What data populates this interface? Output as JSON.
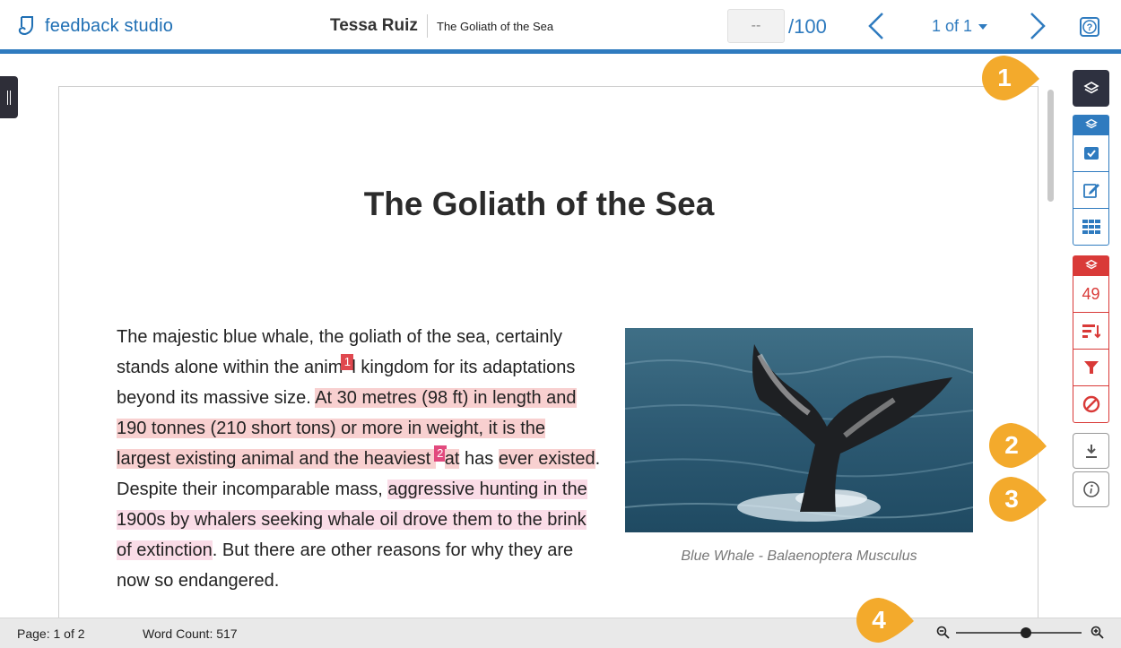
{
  "header": {
    "app_name": "feedback studio",
    "student_name": "Tessa Ruiz",
    "document_title": "The Goliath of the Sea",
    "grade_placeholder": "--",
    "grade_max": "/100",
    "page_selector": "1 of 1"
  },
  "document": {
    "heading": "The Goliath of the Sea",
    "paragraph": {
      "seg1": "The majestic blue whale, the goliath of the sea, certainly stands alone within the anim",
      "mark1": "1",
      "seg2": "l kingdom for its adaptations beyond its massive size. ",
      "hl1": "At 30 metres (98 ft) in length and 190 tonnes (210 short tons) or more in weight, it is the largest existing animal and the heaviest ",
      "mark2": "2",
      "hl1b": "at",
      "seg3": " has ",
      "hl2": "ever existed",
      "seg4": ". Despite their incomparable mass, ",
      "hl3": "aggressive hunting in the 1900s by whalers seeking whale oil drove them to the brink of extinction",
      "seg5": ". But there are other reasons for why they are now so endangered."
    },
    "image_caption": "Blue Whale - Balaenoptera Musculus"
  },
  "toolbar": {
    "flag_count": "49",
    "icons": [
      "layers-icon",
      "checkbox-icon",
      "edit-icon",
      "grid-icon",
      "sort-icon",
      "filter-icon",
      "block-icon",
      "download-icon",
      "info-icon"
    ]
  },
  "callouts": [
    "1",
    "2",
    "3",
    "4"
  ],
  "status": {
    "page": "Page: 1 of 2",
    "word_count": "Word Count: 517"
  },
  "colors": {
    "accent": "#2f7bbf",
    "flag_red": "#d93a38",
    "highlight_pink": "#f8d0d0",
    "highlight_magenta": "#fadce7",
    "callout_orange": "#f3aa2c",
    "dark_button": "#2e3140"
  }
}
